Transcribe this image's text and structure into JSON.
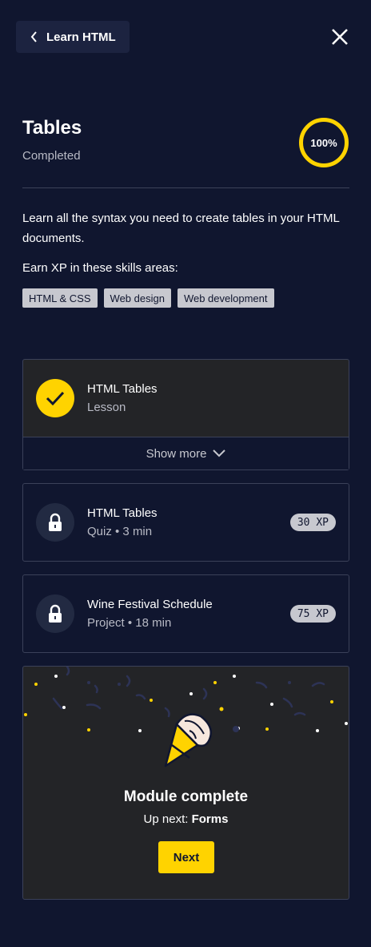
{
  "nav": {
    "back_label": "Learn HTML"
  },
  "module": {
    "title": "Tables",
    "status": "Completed",
    "progress": "100%",
    "description": "Learn all the syntax you need to create tables in your HTML documents.",
    "earn_label": "Earn XP in these skills areas:",
    "skills": [
      "HTML & CSS",
      "Web design",
      "Web development"
    ]
  },
  "items": [
    {
      "title": "HTML Tables",
      "subtitle": "Lesson",
      "state": "completed",
      "icon": "check-icon",
      "show_more": "Show more"
    },
    {
      "title": "HTML Tables",
      "subtitle": "Quiz • 3 min",
      "state": "locked",
      "icon": "lock-icon",
      "xp": "30 XP"
    },
    {
      "title": "Wine Festival Schedule",
      "subtitle": "Project • 18 min",
      "state": "locked",
      "icon": "lock-icon",
      "xp": "75 XP"
    }
  ],
  "complete": {
    "title": "Module complete",
    "upnext_prefix": "Up next:",
    "upnext_name": "Forms",
    "next_label": "Next"
  },
  "colors": {
    "accent": "#ffd300",
    "background": "#10162f",
    "card": "#232427"
  }
}
